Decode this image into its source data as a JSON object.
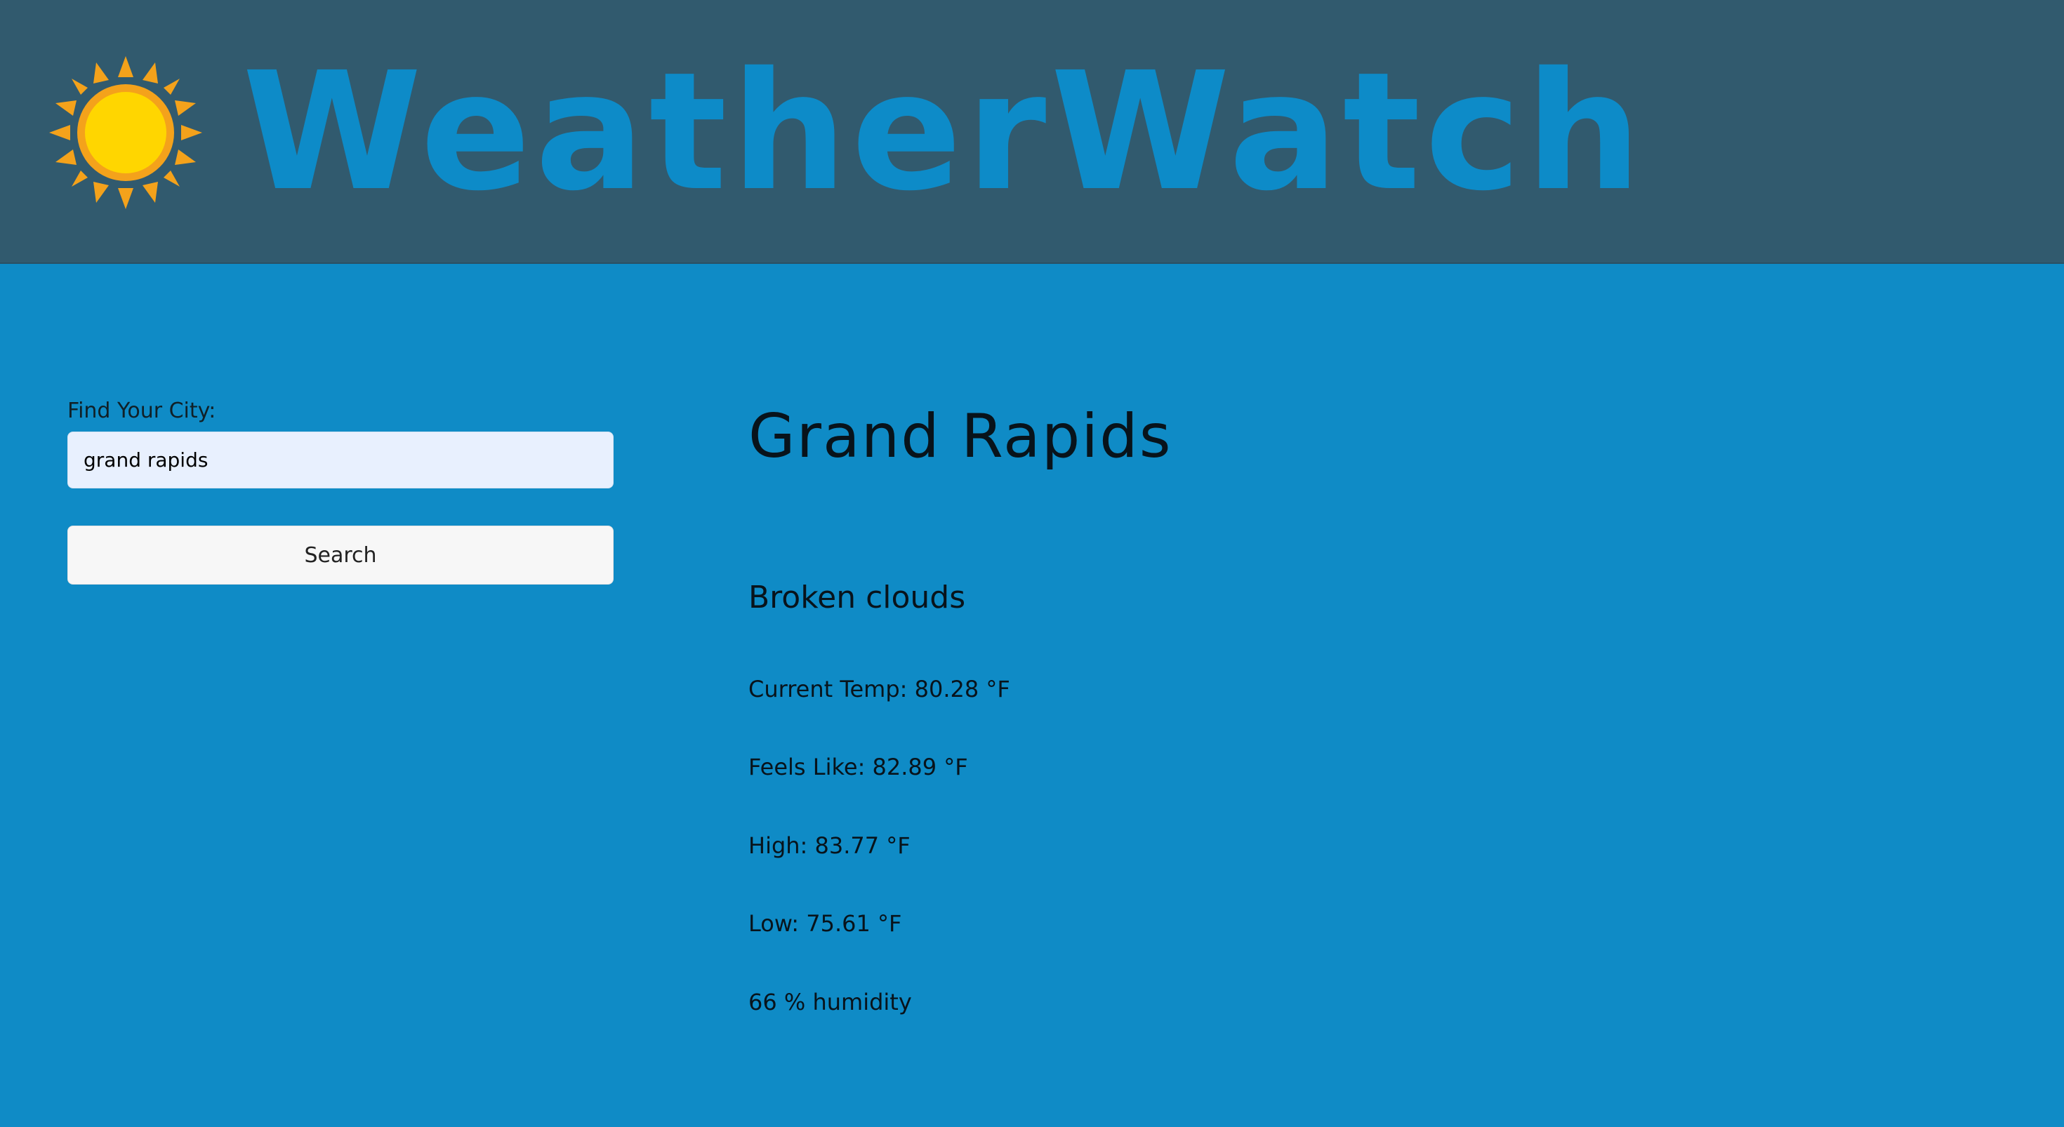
{
  "header": {
    "brand": "WeatherWatch",
    "logo_icon": "sun-icon",
    "colors": {
      "header_bg": "#315a6e",
      "brand_text": "#0d8bc8",
      "sun_core": "#ffd600",
      "sun_rays": "#f4a21b"
    }
  },
  "sidebar": {
    "label": "Find Your City:",
    "input_value": "grand rapids",
    "button_label": "Search"
  },
  "weather": {
    "city": "Grand Rapids",
    "condition": "Broken clouds",
    "current_temp": "Current Temp: 80.28 °F",
    "feels_like": "Feels Like: 82.89 °F",
    "high": "High: 83.77 °F",
    "low": "Low: 75.61 °F",
    "humidity": "66 % humidity"
  },
  "colors": {
    "page_bg": "#0f8bc6",
    "input_bg": "#e8f0fe",
    "button_bg": "#f7f7f7"
  }
}
